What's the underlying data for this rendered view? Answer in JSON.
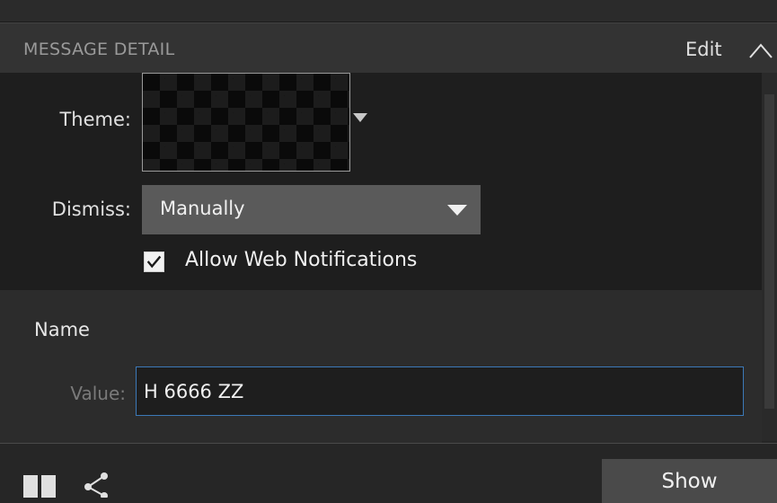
{
  "header": {
    "title": "MESSAGE DETAIL",
    "edit_label": "Edit",
    "collapse_icon": "chevron-up-icon"
  },
  "settings": {
    "theme_label": "Theme:",
    "theme_dropdown_icon": "caret-down-icon",
    "dismiss_label": "Dismiss:",
    "dismiss_value": "Manually",
    "allow_web_notifications_label": "Allow Web Notifications",
    "allow_web_notifications_checked": true
  },
  "name_section": {
    "name_label": "Name",
    "value_label": "Value:",
    "value": "H 6666 ZZ"
  },
  "footer": {
    "layout_icon": "split-columns-icon",
    "share_icon": "share-icon",
    "show_label": "Show"
  },
  "colors": {
    "input_focus_border": "#3c79b8",
    "panel_bg": "#1e1e1e",
    "section_bg": "#2c2c2c"
  }
}
